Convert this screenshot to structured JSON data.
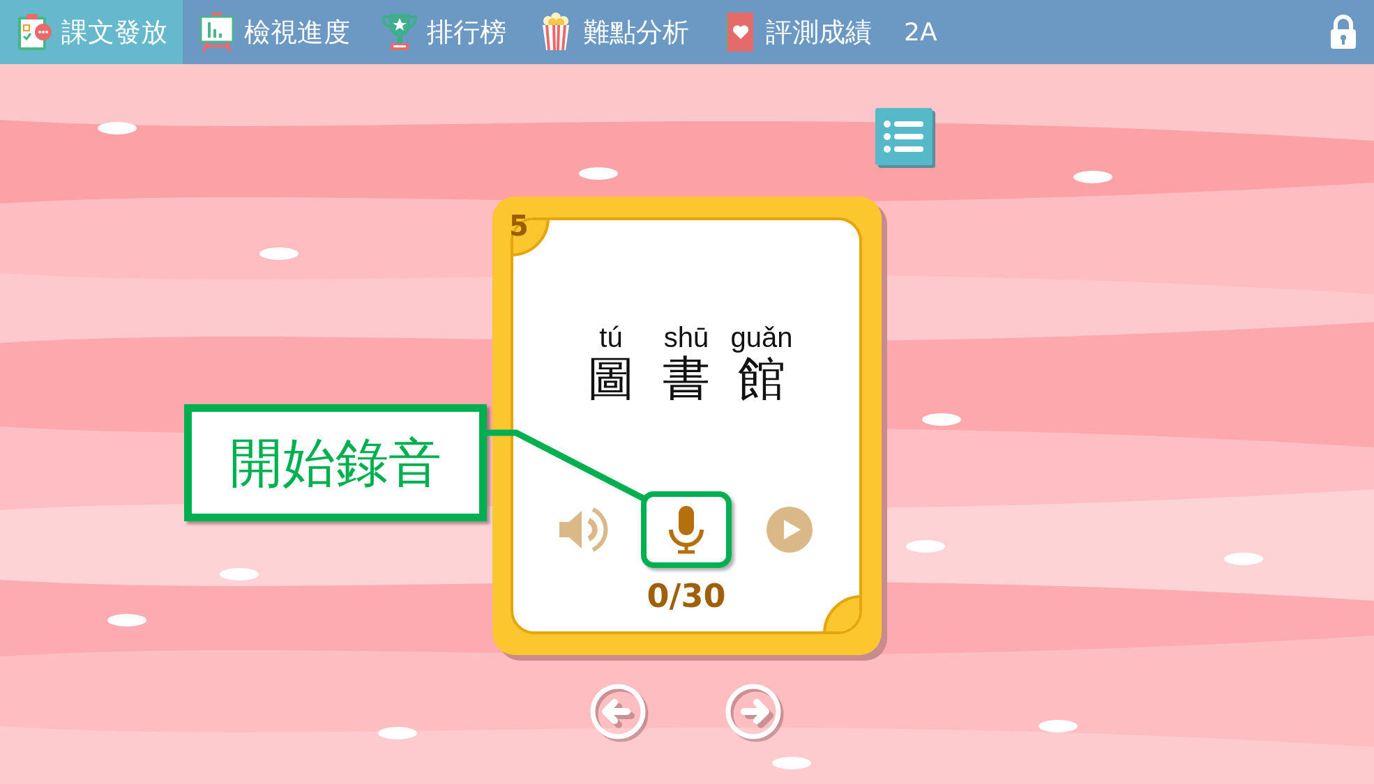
{
  "nav": {
    "tabs": [
      {
        "label": "課文發放",
        "selected": true
      },
      {
        "label": "檢視進度",
        "selected": false
      },
      {
        "label": "排行榜",
        "selected": false
      },
      {
        "label": "難點分析",
        "selected": false
      },
      {
        "label": "評測成績",
        "selected": false
      }
    ],
    "class_label": "2A"
  },
  "card": {
    "number": "5",
    "words": [
      {
        "pinyin": "tú",
        "character": "圖"
      },
      {
        "pinyin": "shū",
        "character": "書"
      },
      {
        "pinyin": "guǎn",
        "character": "館"
      }
    ],
    "controls": [
      {
        "kind": "speaker",
        "disabled": true,
        "highlighted": false
      },
      {
        "kind": "record",
        "disabled": false,
        "highlighted": true
      },
      {
        "kind": "play",
        "disabled": true,
        "highlighted": false
      }
    ],
    "record_count": "0/30"
  },
  "callout": {
    "text": "開始錄音"
  }
}
